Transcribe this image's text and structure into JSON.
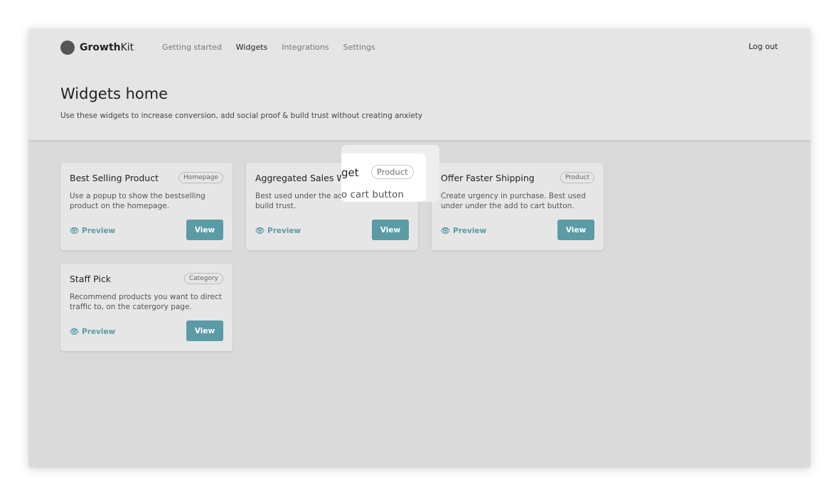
{
  "brand": {
    "bold": "Growth",
    "rest": "Kit"
  },
  "nav": [
    "Getting started",
    "Widgets",
    "Integrations",
    "Settings"
  ],
  "logout": "Log out",
  "page": {
    "title": "Widgets home",
    "subtitle": "Use these widgets to increase conversion, add social proof & build trust without creating anxiety"
  },
  "preview_label": "Preview",
  "view_label": "View",
  "accent": "#5a9ba6",
  "cards": [
    {
      "title": "Best Selling Product",
      "badge": "Homepage",
      "desc": "Use a popup to show the bestselling product on the homepage."
    },
    {
      "title": "Aggregated Sales Widget",
      "badge": "Product",
      "desc": "Best used under the add to cart button to build trust."
    },
    {
      "title": "Offer Faster Shipping",
      "badge": "Product",
      "desc": "Create urgency in purchase. Best used under under the add to cart button."
    },
    {
      "title": "Staff Pick",
      "badge": "Category",
      "desc": "Recommend products you want to direct traffic to, on the catergory page."
    }
  ],
  "magnifier": {
    "title_fragment": "get",
    "badge": "Product",
    "desc_fragment": "o cart button"
  }
}
